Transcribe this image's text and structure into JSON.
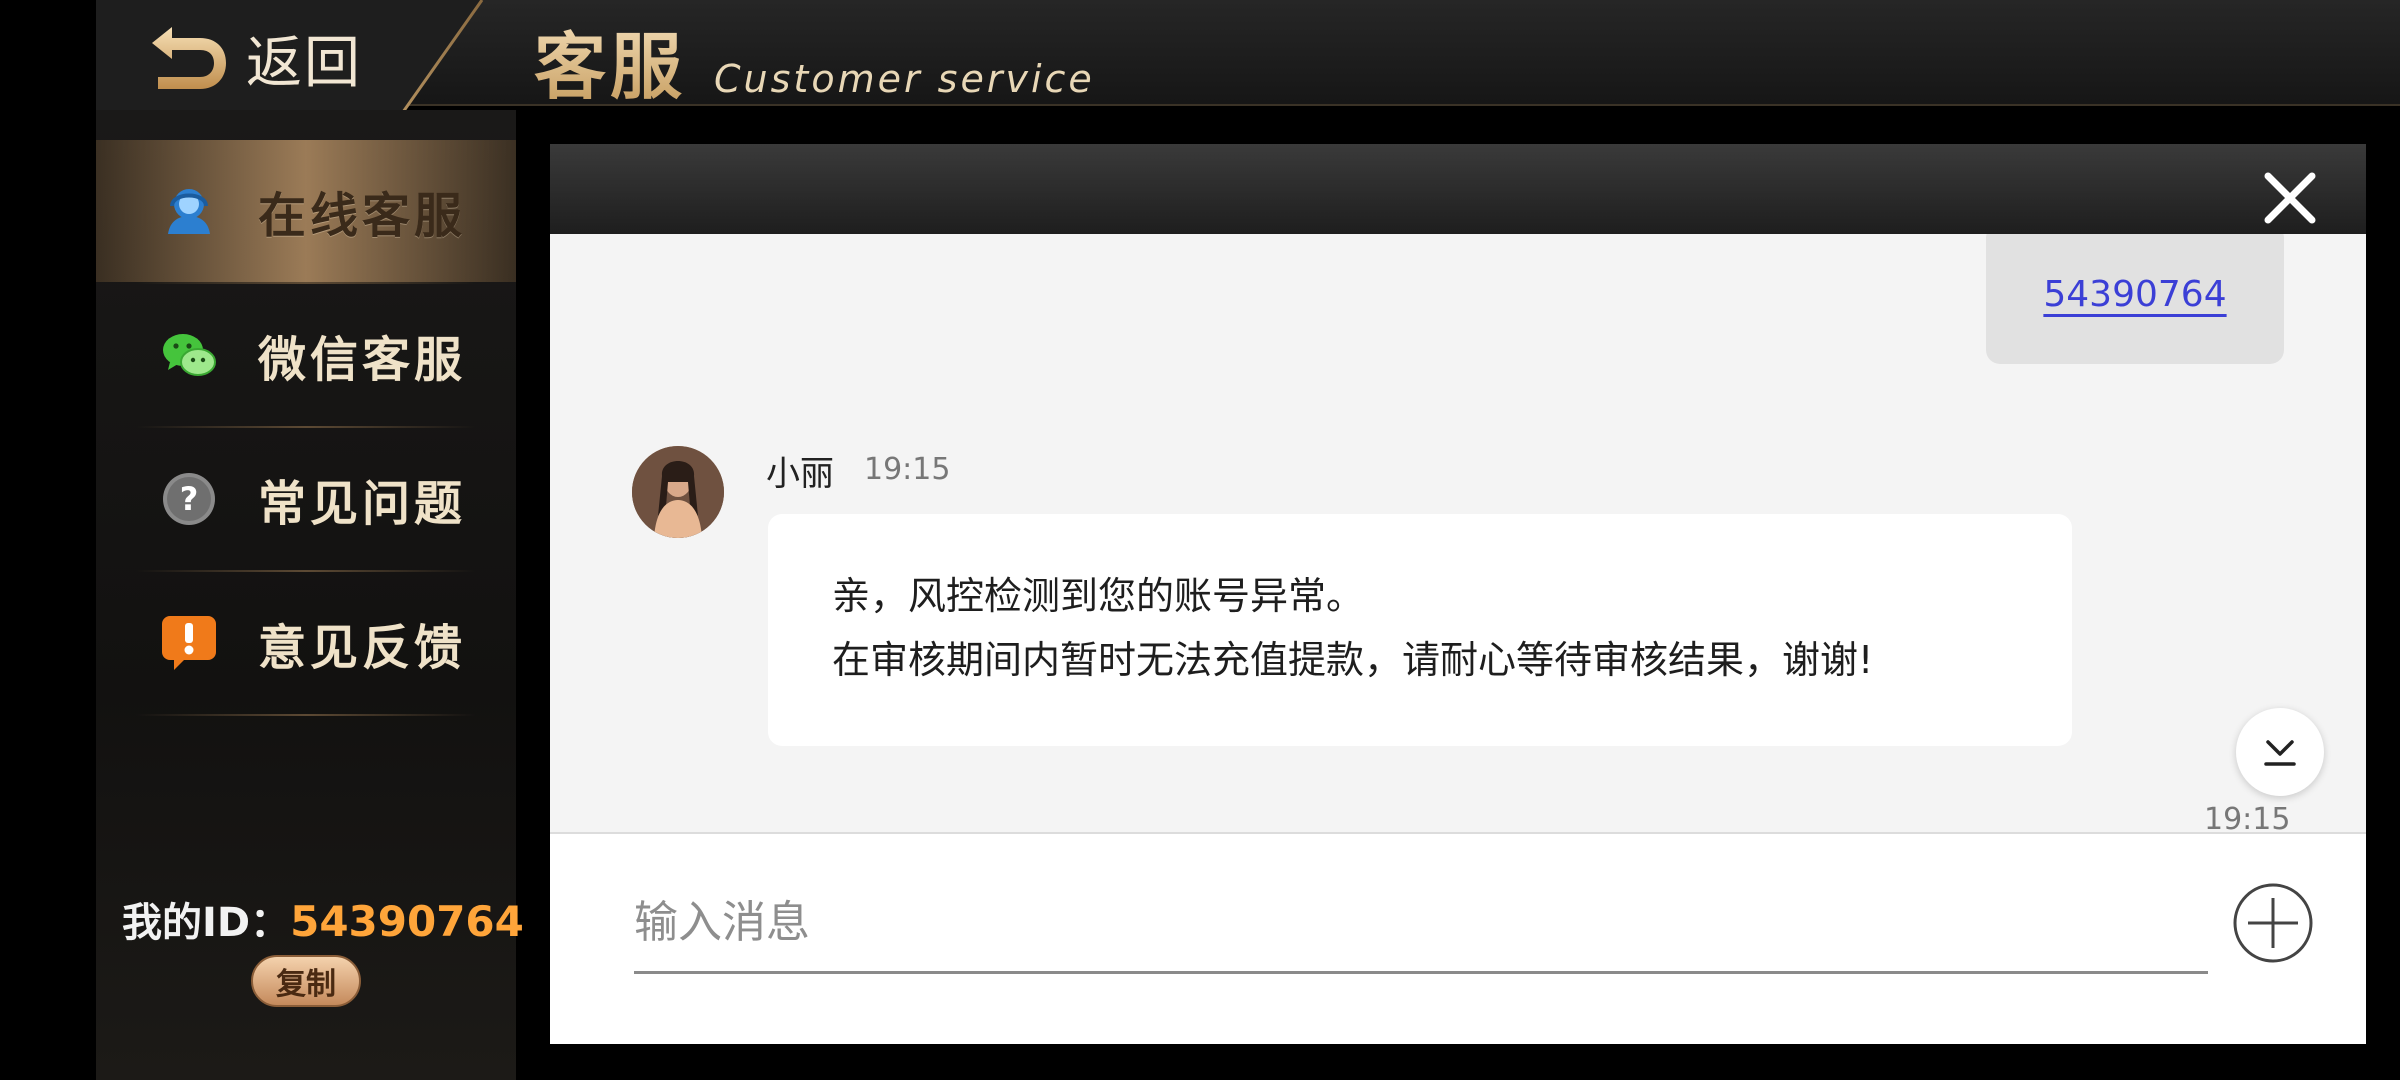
{
  "header": {
    "back_label": "返回",
    "title_cn": "客服",
    "title_en": "Customer service"
  },
  "sidebar": {
    "items": [
      {
        "label": "在线客服",
        "icon": "headset-user-icon",
        "active": true
      },
      {
        "label": "微信客服",
        "icon": "wechat-icon",
        "active": false
      },
      {
        "label": "常见问题",
        "icon": "question-icon",
        "active": false
      },
      {
        "label": "意见反馈",
        "icon": "exclamation-bubble-icon",
        "active": false
      }
    ],
    "my_id_label": "我的ID：",
    "my_id_value": "54390764",
    "copy_label": "复制"
  },
  "chat": {
    "self_message": "54390764",
    "agent_name": "小丽",
    "agent_time": "19:15",
    "agent_lines": [
      "亲，风控检测到您的账号异常。",
      "在审核期间内暂时无法充值提款，请耐心等待审核结果，谢谢!"
    ],
    "last_time": "19:15",
    "input_placeholder": "输入消息"
  },
  "colors": {
    "gold_accent": "#c49a5b",
    "id_orange": "#ffa53a",
    "link_blue": "#3b3fd6"
  }
}
